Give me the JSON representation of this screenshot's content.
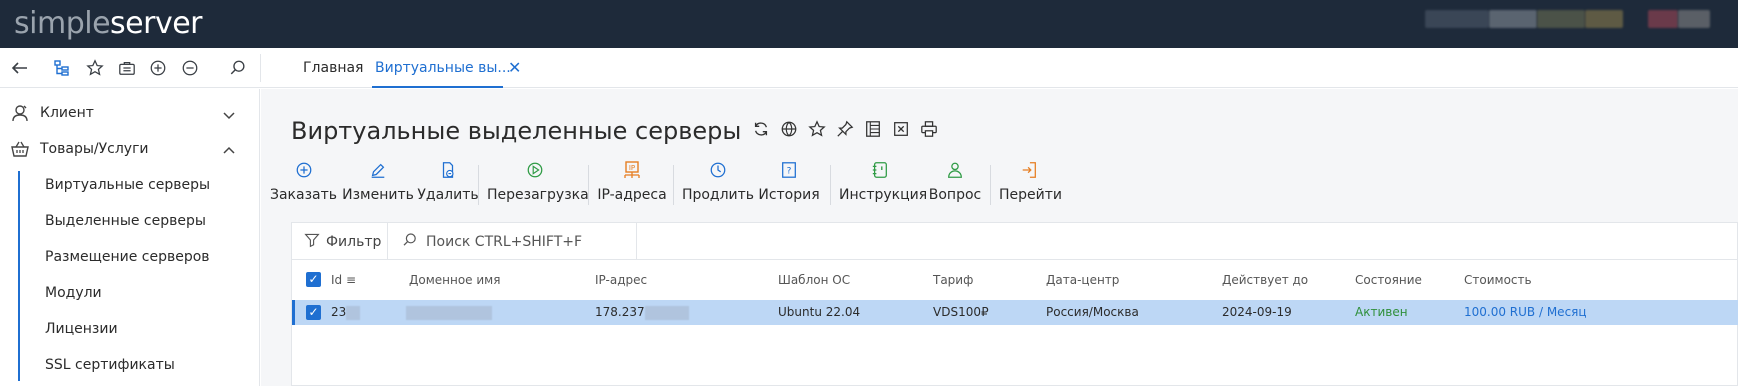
{
  "app": {
    "logo_light": "simple",
    "logo_dark": "server"
  },
  "tabs": [
    {
      "label": "Главная"
    },
    {
      "label": "Виртуальные вы..."
    }
  ],
  "sidebar": {
    "groups": [
      {
        "label": "Клиент",
        "icon": "client-icon",
        "expanded": false
      },
      {
        "label": "Товары/Услуги",
        "icon": "basket-icon",
        "expanded": true
      }
    ],
    "items": [
      {
        "label": "Виртуальные серверы"
      },
      {
        "label": "Выделенные серверы"
      },
      {
        "label": "Размещение серверов"
      },
      {
        "label": "Модули"
      },
      {
        "label": "Лицензии"
      },
      {
        "label": "SSL сертификаты"
      }
    ]
  },
  "main": {
    "title": "Виртуальные выделенные серверы",
    "actions": [
      {
        "label": "Заказать",
        "icon": "plus-circle-icon",
        "color": "#1f6fd1"
      },
      {
        "label": "Изменить",
        "icon": "pencil-icon",
        "color": "#1f6fd1"
      },
      {
        "label": "Удалить",
        "icon": "delete-doc-icon",
        "color": "#1f6fd1"
      },
      {
        "label": "Перезагрузка",
        "icon": "restart-icon",
        "color": "#2f9b45"
      },
      {
        "label": "IP-адреса",
        "icon": "ip-icon",
        "color": "#e67e22"
      },
      {
        "label": "Продлить",
        "icon": "clock-icon",
        "color": "#1f6fd1"
      },
      {
        "label": "История",
        "icon": "history-icon",
        "color": "#1f6fd1"
      },
      {
        "label": "Инструкция",
        "icon": "instruction-icon",
        "color": "#2f9b45"
      },
      {
        "label": "Вопрос",
        "icon": "question-user-icon",
        "color": "#2f9b45"
      },
      {
        "label": "Перейти",
        "icon": "goto-icon",
        "color": "#e67e22"
      }
    ],
    "filter_label": "Фильтр",
    "search_placeholder": "Поиск CTRL+SHIFT+F",
    "columns": [
      "Id",
      "Доменное имя",
      "IP-адрес",
      "Шаблон ОС",
      "Тариф",
      "Дата-центр",
      "Действует до",
      "Состояние",
      "Стоимость"
    ],
    "rows": [
      {
        "id": "23",
        "domain": "",
        "ip": "178.237",
        "os": "Ubuntu 22.04",
        "tariff": "VDS100₽",
        "datacenter": "Россия/Москва",
        "valid_until": "2024-09-19",
        "status": "Активен",
        "cost": "100.00 RUB / Месяц"
      }
    ]
  }
}
